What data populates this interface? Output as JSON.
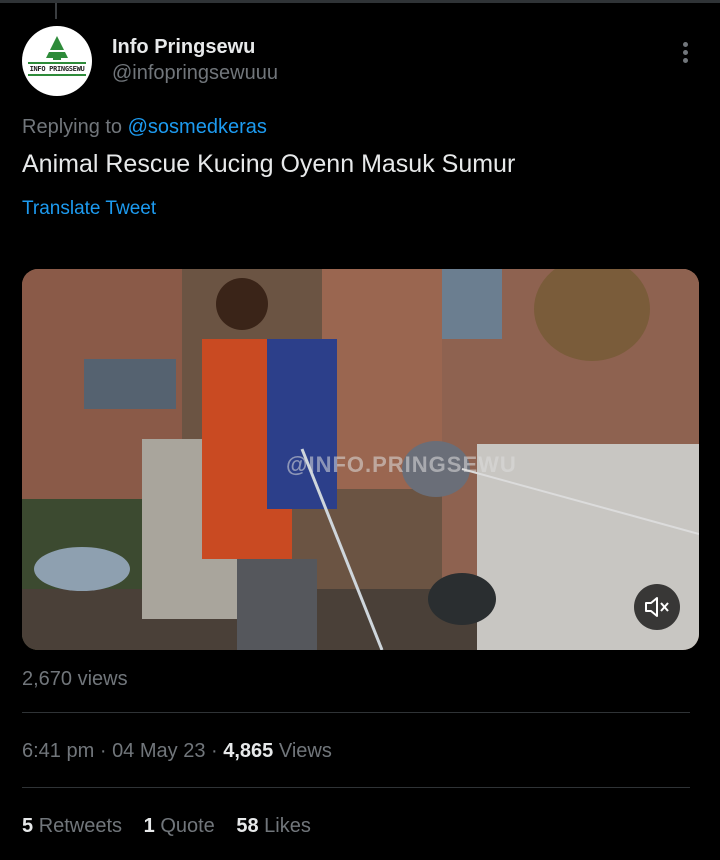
{
  "author": {
    "name": "Info Pringsewu",
    "handle": "@infopringsewuuu",
    "avatar_text": "INFO PRINGSEWU"
  },
  "reply": {
    "prefix": "Replying to",
    "mention": "@sosmedkeras"
  },
  "tweet": {
    "text": "Animal Rescue Kucing Oyenn Masuk Sumur",
    "translate_label": "Translate Tweet"
  },
  "media": {
    "watermark": "@INFO.PRINGSEWU",
    "mute_icon": "speaker-muted-icon"
  },
  "video_views": "2,670 views",
  "meta": {
    "time": "6:41 pm",
    "separator": "·",
    "date": "04 May 23",
    "views_count": "4,865",
    "views_label": "Views"
  },
  "stats": [
    {
      "count": "5",
      "label": "Retweets"
    },
    {
      "count": "1",
      "label": "Quote"
    },
    {
      "count": "58",
      "label": "Likes"
    }
  ],
  "colors": {
    "background": "#000000",
    "text": "#e7e9ea",
    "secondary": "#71767b",
    "link": "#1d9bf0",
    "divider": "#2f3336"
  }
}
